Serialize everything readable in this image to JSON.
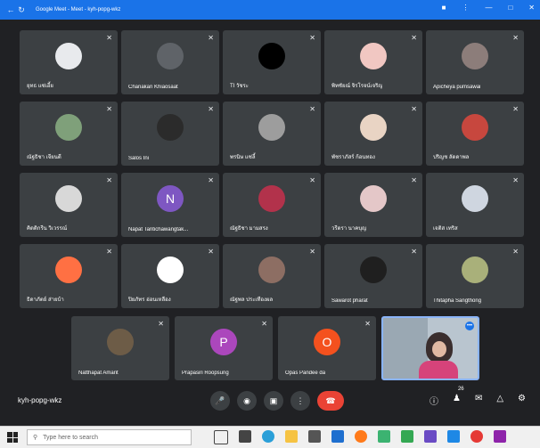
{
  "window": {
    "title": "Google Meet - Meet - kyh-popg-wkz",
    "back_icon": "back-arrow-icon",
    "reload_icon": "reload-icon",
    "right_icons": [
      "profile-icon",
      "more-vert-icon",
      "minimize-icon",
      "restore-icon",
      "close-icon"
    ]
  },
  "participants": [
    {
      "name": "ยุทธ แซ่เอี้ย",
      "initial": "",
      "avatar_color": "#e8eaed"
    },
    {
      "name": "Chanakan Khiaosaat",
      "initial": "",
      "avatar_color": "#5f6368"
    },
    {
      "name": "TI วัชระ",
      "initial": "",
      "avatar_color": "#000000"
    },
    {
      "name": "พิทชัยณ์ จิรโรจน์เจริญ",
      "initial": "",
      "avatar_color": "#f1c7c2"
    },
    {
      "name": "Apicheya pumsawai",
      "initial": "",
      "avatar_color": "#8c7d7a"
    },
    {
      "name": "ณัฐธิชา เจียนดี",
      "initial": "",
      "avatar_color": "#7fa07a"
    },
    {
      "name": "Salos Ini",
      "initial": "",
      "avatar_color": "#2b2b2b"
    },
    {
      "name": "พรนิษ แซ่ลี้",
      "initial": "",
      "avatar_color": "#9d9d9d"
    },
    {
      "name": "พัชราภัสร์ ก้อนทอง",
      "initial": "",
      "avatar_color": "#e9d4c4"
    },
    {
      "name": "ปริญช ลัดดาพล",
      "initial": "",
      "avatar_color": "#c7473e"
    },
    {
      "name": "คิดติกรีน วิเวรรณ์",
      "initial": "",
      "avatar_color": "#d8d8d8"
    },
    {
      "name": "Napat Tantichawangtak...",
      "initial": "N",
      "avatar_color": "#7e57c2"
    },
    {
      "name": "ณัฐธิชา มามสรง",
      "initial": "",
      "avatar_color": "#b2324b"
    },
    {
      "name": "วรีดรา นาคบุญ",
      "initial": "",
      "avatar_color": "#e4c7c8"
    },
    {
      "name": "เจติส เทริส",
      "initial": "",
      "avatar_color": "#cfd6e0"
    },
    {
      "name": "ธิดาภัตย์ ส่ายบ้า",
      "initial": "",
      "avatar_color": "#ff7043"
    },
    {
      "name": "ปิยภัทร อ่อนเหลือง",
      "initial": "",
      "avatar_color": "#ffffff"
    },
    {
      "name": "ณัฐพล ประเทืองผล",
      "initial": "",
      "avatar_color": "#8d6e63"
    },
    {
      "name": "Sawarot pharat",
      "initial": "",
      "avatar_color": "#1f1f1f"
    },
    {
      "name": "Thitapha Sangthong",
      "initial": "",
      "avatar_color": "#a9b07a"
    },
    {
      "name": "Natthapat Amarit",
      "initial": "",
      "avatar_color": "#6d5c47"
    },
    {
      "name": "Prapasiri Roopsung",
      "initial": "P",
      "avatar_color": "#ab47bc"
    },
    {
      "name": "Opas Pandee da",
      "initial": "O",
      "avatar_color": "#f4511e"
    }
  ],
  "self_view": {
    "badge": "•••"
  },
  "bottom_bar": {
    "meeting_code": "kyh-popg-wkz",
    "controls": [
      "mic-icon",
      "camera-icon",
      "present-icon",
      "more-options-icon",
      "end-call-icon"
    ],
    "participants_count": "26",
    "right_icons": [
      "info-icon",
      "people-icon",
      "chat-icon",
      "activities-icon",
      "host-controls-icon"
    ]
  },
  "taskbar": {
    "search_placeholder": "Type here to search",
    "app_icons": [
      "task-view-icon",
      "widgets-icon",
      "edge-icon",
      "file-explorer-icon",
      "store-icon",
      "dropbox-icon",
      "firefox-icon",
      "photos-icon",
      "meet-icon",
      "app-icon",
      "mail-icon",
      "chrome-icon",
      "app-icon-2"
    ],
    "colors": {
      "accent": "#1a73e8",
      "end_call": "#ea4335"
    }
  }
}
